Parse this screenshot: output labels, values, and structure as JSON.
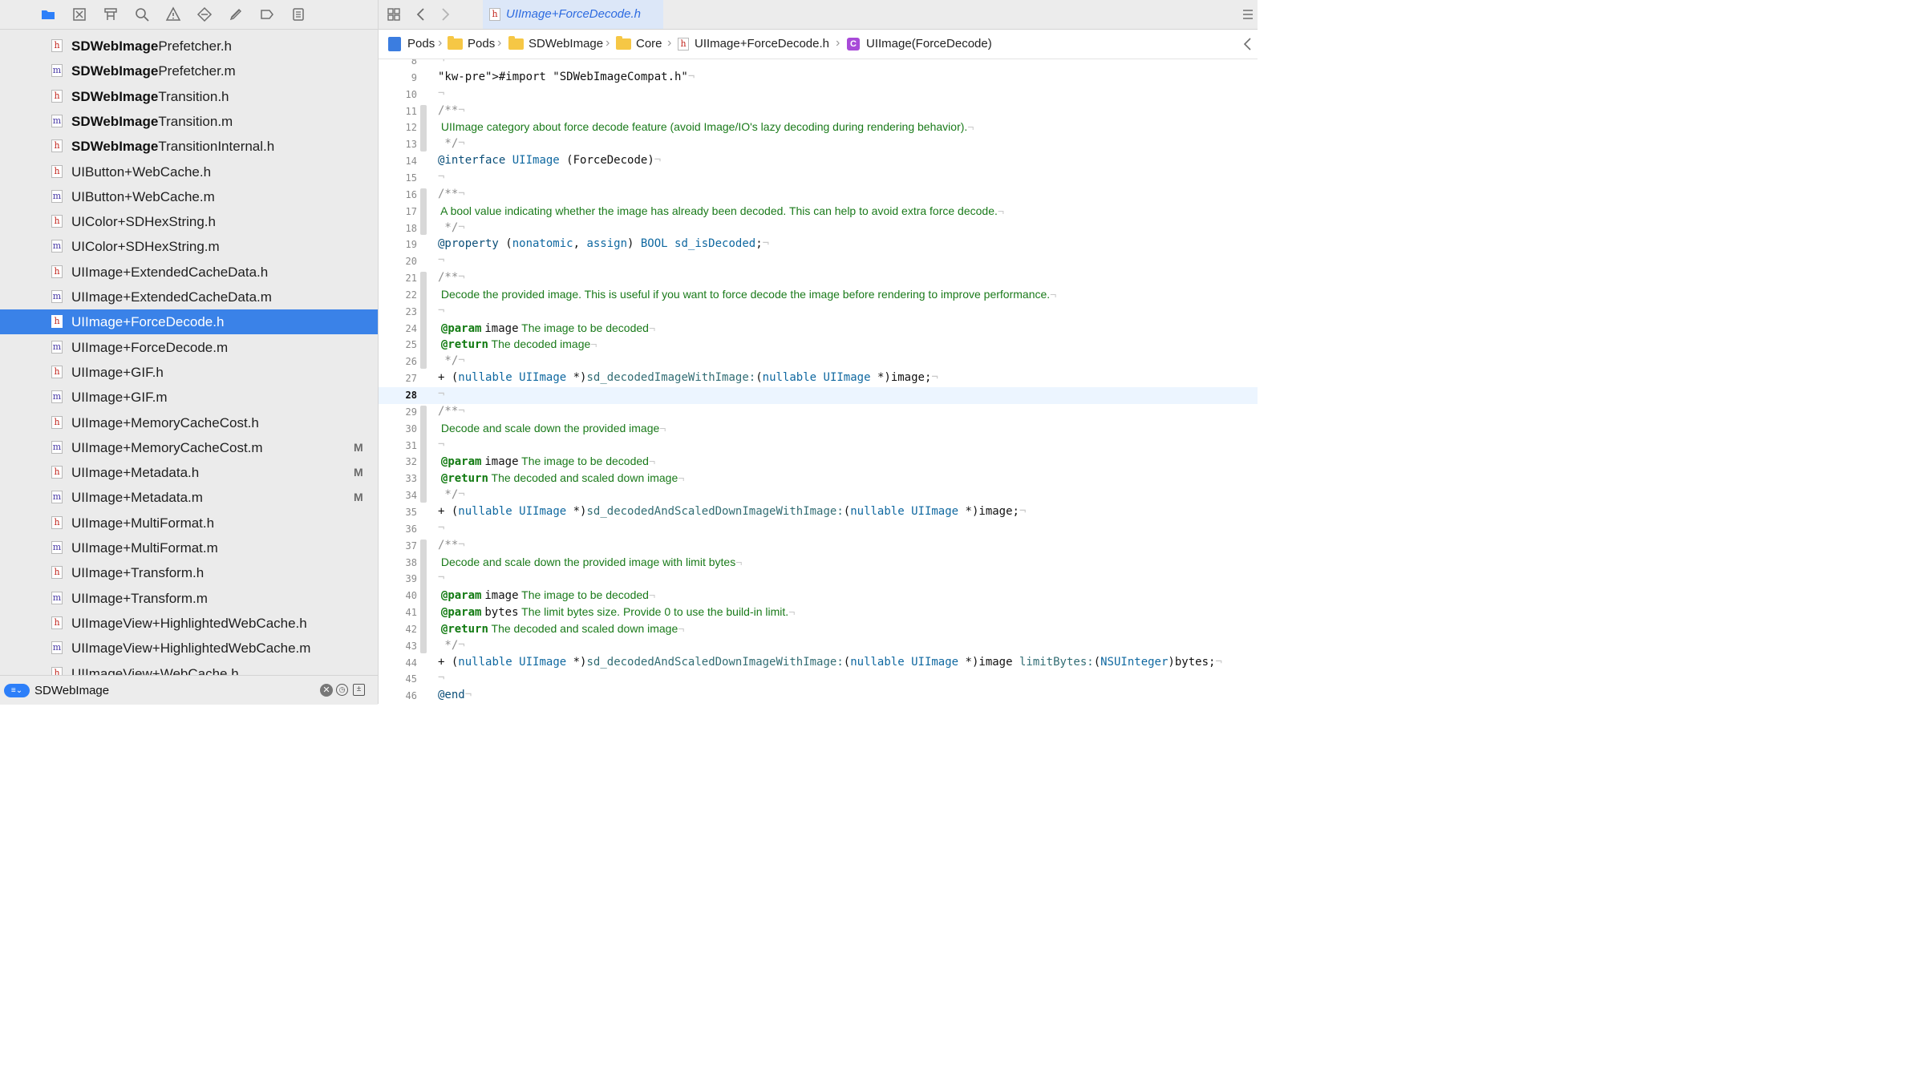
{
  "navigator": {
    "toolbar_icons": [
      "folder-icon",
      "source-control-icon",
      "hierarchy-icon",
      "search-icon",
      "warning-icon",
      "test-icon",
      "debug-icon",
      "breakpoint-icon",
      "report-icon"
    ],
    "files": [
      {
        "type": "h",
        "bold": "SDWebImage",
        "rest": "Prefetcher.h",
        "badge": ""
      },
      {
        "type": "m",
        "bold": "SDWebImage",
        "rest": "Prefetcher.m",
        "badge": ""
      },
      {
        "type": "h",
        "bold": "SDWebImage",
        "rest": "Transition.h",
        "badge": ""
      },
      {
        "type": "m",
        "bold": "SDWebImage",
        "rest": "Transition.m",
        "badge": ""
      },
      {
        "type": "h",
        "bold": "SDWebImage",
        "rest": "TransitionInternal.h",
        "badge": ""
      },
      {
        "type": "h",
        "bold": "",
        "rest": "UIButton+WebCache.h",
        "badge": ""
      },
      {
        "type": "m",
        "bold": "",
        "rest": "UIButton+WebCache.m",
        "badge": ""
      },
      {
        "type": "h",
        "bold": "",
        "rest": "UIColor+SDHexString.h",
        "badge": ""
      },
      {
        "type": "m",
        "bold": "",
        "rest": "UIColor+SDHexString.m",
        "badge": ""
      },
      {
        "type": "h",
        "bold": "",
        "rest": "UIImage+ExtendedCacheData.h",
        "badge": ""
      },
      {
        "type": "m",
        "bold": "",
        "rest": "UIImage+ExtendedCacheData.m",
        "badge": ""
      },
      {
        "type": "h",
        "bold": "",
        "rest": "UIImage+ForceDecode.h",
        "badge": "",
        "selected": true
      },
      {
        "type": "m",
        "bold": "",
        "rest": "UIImage+ForceDecode.m",
        "badge": ""
      },
      {
        "type": "h",
        "bold": "",
        "rest": "UIImage+GIF.h",
        "badge": ""
      },
      {
        "type": "m",
        "bold": "",
        "rest": "UIImage+GIF.m",
        "badge": ""
      },
      {
        "type": "h",
        "bold": "",
        "rest": "UIImage+MemoryCacheCost.h",
        "badge": ""
      },
      {
        "type": "m",
        "bold": "",
        "rest": "UIImage+MemoryCacheCost.m",
        "badge": "M"
      },
      {
        "type": "h",
        "bold": "",
        "rest": "UIImage+Metadata.h",
        "badge": "M"
      },
      {
        "type": "m",
        "bold": "",
        "rest": "UIImage+Metadata.m",
        "badge": "M"
      },
      {
        "type": "h",
        "bold": "",
        "rest": "UIImage+MultiFormat.h",
        "badge": ""
      },
      {
        "type": "m",
        "bold": "",
        "rest": "UIImage+MultiFormat.m",
        "badge": ""
      },
      {
        "type": "h",
        "bold": "",
        "rest": "UIImage+Transform.h",
        "badge": ""
      },
      {
        "type": "m",
        "bold": "",
        "rest": "UIImage+Transform.m",
        "badge": ""
      },
      {
        "type": "h",
        "bold": "",
        "rest": "UIImageView+HighlightedWebCache.h",
        "badge": ""
      },
      {
        "type": "m",
        "bold": "",
        "rest": "UIImageView+HighlightedWebCache.m",
        "badge": ""
      },
      {
        "type": "h",
        "bold": "",
        "rest": "UIImageView+WebCache.h",
        "badge": ""
      }
    ],
    "filter": {
      "value": "SDWebImage"
    }
  },
  "editor": {
    "tab_label": "UIImage+ForceDecode.h",
    "breadcrumb": [
      "Pods",
      "Pods",
      "SDWebImage",
      "Core",
      "UIImage+ForceDecode.h",
      "UIImage(ForceDecode)"
    ],
    "current_line": "28",
    "lines": [
      {
        "n": "8",
        "t": ""
      },
      {
        "n": "9",
        "t": "#import \"SDWebImageCompat.h\""
      },
      {
        "n": "10",
        "t": ""
      },
      {
        "n": "11",
        "t": "/**"
      },
      {
        "n": "12",
        "t": " UIImage category about force decode feature (avoid Image/IO's lazy decoding during rendering behavior)."
      },
      {
        "n": "13",
        "t": " */"
      },
      {
        "n": "14",
        "t": "@interface UIImage (ForceDecode)"
      },
      {
        "n": "15",
        "t": ""
      },
      {
        "n": "16",
        "t": "/**"
      },
      {
        "n": "17",
        "t": " A bool value indicating whether the image has already been decoded. This can help to avoid extra force decode."
      },
      {
        "n": "18",
        "t": " */"
      },
      {
        "n": "19",
        "t": "@property (nonatomic, assign) BOOL sd_isDecoded;"
      },
      {
        "n": "20",
        "t": ""
      },
      {
        "n": "21",
        "t": "/**"
      },
      {
        "n": "22",
        "t": " Decode the provided image. This is useful if you want to force decode the image before rendering to improve performance."
      },
      {
        "n": "23",
        "t": ""
      },
      {
        "n": "24",
        "t": " @param image The image to be decoded"
      },
      {
        "n": "25",
        "t": " @return The decoded image"
      },
      {
        "n": "26",
        "t": " */"
      },
      {
        "n": "27",
        "t": "+ (nullable UIImage *)sd_decodedImageWithImage:(nullable UIImage *)image;"
      },
      {
        "n": "28",
        "t": ""
      },
      {
        "n": "29",
        "t": "/**"
      },
      {
        "n": "30",
        "t": " Decode and scale down the provided image"
      },
      {
        "n": "31",
        "t": ""
      },
      {
        "n": "32",
        "t": " @param image The image to be decoded"
      },
      {
        "n": "33",
        "t": " @return The decoded and scaled down image"
      },
      {
        "n": "34",
        "t": " */"
      },
      {
        "n": "35",
        "t": "+ (nullable UIImage *)sd_decodedAndScaledDownImageWithImage:(nullable UIImage *)image;"
      },
      {
        "n": "36",
        "t": ""
      },
      {
        "n": "37",
        "t": "/**"
      },
      {
        "n": "38",
        "t": " Decode and scale down the provided image with limit bytes"
      },
      {
        "n": "39",
        "t": ""
      },
      {
        "n": "40",
        "t": " @param image The image to be decoded"
      },
      {
        "n": "41",
        "t": " @param bytes The limit bytes size. Provide 0 to use the build-in limit."
      },
      {
        "n": "42",
        "t": " @return The decoded and scaled down image"
      },
      {
        "n": "43",
        "t": " */"
      },
      {
        "n": "44",
        "t": "+ (nullable UIImage *)sd_decodedAndScaledDownImageWithImage:(nullable UIImage *)image limitBytes:(NSUInteger)bytes;"
      },
      {
        "n": "45",
        "t": ""
      },
      {
        "n": "46",
        "t": "@end"
      }
    ]
  }
}
